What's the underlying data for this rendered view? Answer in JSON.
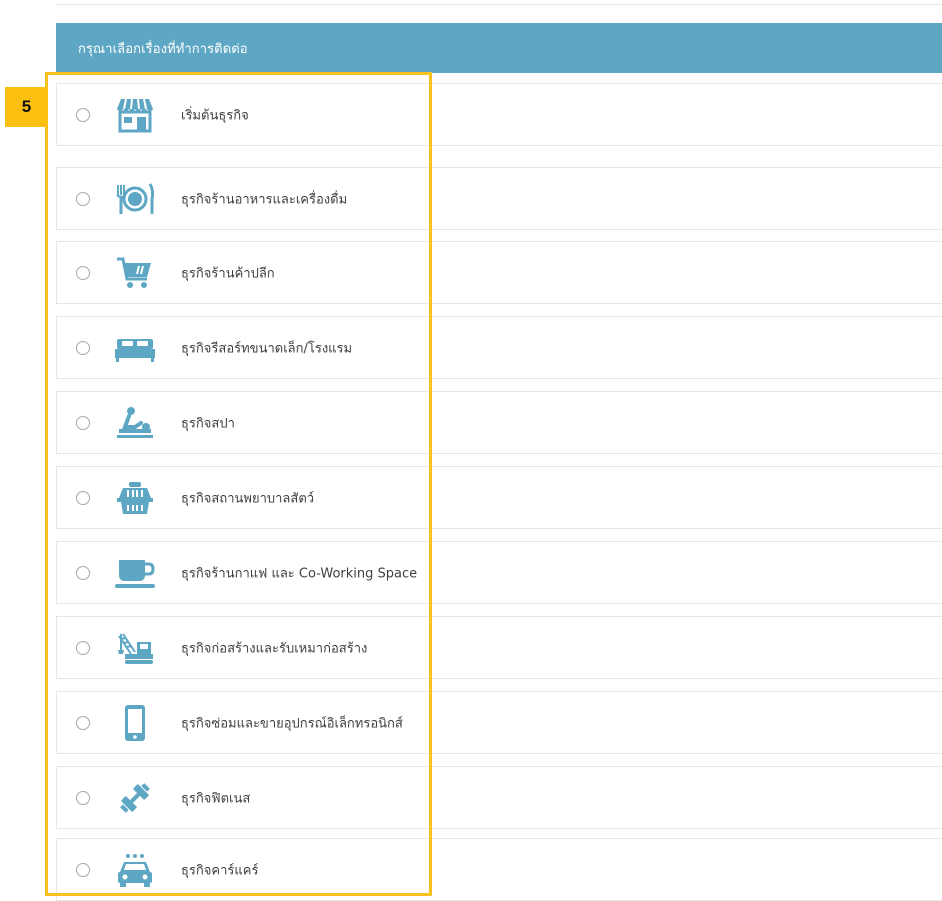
{
  "header": {
    "title": "กรุณาเลือกเรื่องที่ทำการติดต่อ"
  },
  "step_badge": "5",
  "accent_color": "#5ea7c4",
  "highlight_color": "#f7c21c",
  "options": [
    {
      "label": "เริ่มต้นธุรกิจ",
      "icon": "storefront-icon",
      "selected": false
    },
    {
      "label": "ธุรกิจร้านอาหารและเครื่องดื่ม",
      "icon": "fork-plate-knife-icon",
      "selected": false
    },
    {
      "label": "ธุรกิจร้านค้าปลีก",
      "icon": "shopping-cart-icon",
      "selected": false
    },
    {
      "label": "ธุรกิจรีสอร์ทขนาดเล็ก/โรงแรม",
      "icon": "bed-icon",
      "selected": false
    },
    {
      "label": "ธุรกิจสปา",
      "icon": "massage-icon",
      "selected": false
    },
    {
      "label": "ธุรกิจสถานพยาบาลสัตว์",
      "icon": "pet-carrier-icon",
      "selected": false
    },
    {
      "label": "ธุรกิจร้านกาแฟ และ Co-Working Space",
      "icon": "coffee-cup-icon",
      "selected": false
    },
    {
      "label": "ธุรกิจก่อสร้างและรับเหมาก่อสร้าง",
      "icon": "crane-truck-icon",
      "selected": false
    },
    {
      "label": "ธุรกิจซ่อมและขายอุปกรณ์อิเล็กทรอนิกส์",
      "icon": "smartphone-icon",
      "selected": false
    },
    {
      "label": "ธุรกิจฟิตเนส",
      "icon": "dumbbell-icon",
      "selected": false
    },
    {
      "label": "ธุรกิจคาร์แคร์",
      "icon": "car-wash-icon",
      "selected": false
    }
  ]
}
